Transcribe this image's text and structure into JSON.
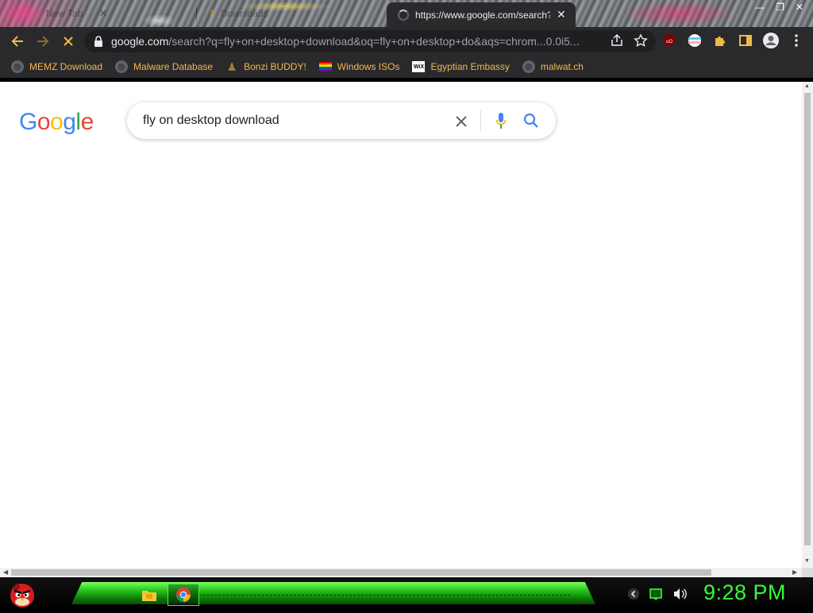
{
  "browser": {
    "tabs": [
      {
        "title": "New Tab",
        "active": false
      },
      {
        "title": "Downloads",
        "active": false
      },
      {
        "title": "https://www.google.com/search?",
        "active": true,
        "loading": true
      }
    ],
    "window_controls": [
      "minimize",
      "restore",
      "close"
    ]
  },
  "toolbar": {
    "url_host": "google.com",
    "url_rest": "/search?q=fly+on+desktop+download&oq=fly+on+desktop+do&aqs=chrom...0.0i5...",
    "extension_icons": [
      "ublock-icon",
      "vpn-icon",
      "extensions-puzzle-icon",
      "sidepanel-icon",
      "profile-icon",
      "kebab-menu-icon"
    ]
  },
  "bookmarks": [
    {
      "label": "MEMZ Download",
      "icon": "globe-icon"
    },
    {
      "label": "Malware Database",
      "icon": "globe-icon"
    },
    {
      "label": "Bonzi BUDDY!",
      "icon": "bonzi-icon"
    },
    {
      "label": "Windows ISOs",
      "icon": "rainbow-flag-icon"
    },
    {
      "label": "Egyptian Embassy",
      "icon": "wix-icon"
    },
    {
      "label": "malwat.ch",
      "icon": "globe-icon"
    }
  ],
  "google": {
    "logo": "Google",
    "query": "fly on desktop download"
  },
  "colors": {
    "g_blue": "#4285F4",
    "g_red": "#EA4335",
    "g_yellow": "#FBBC05",
    "g_green": "#34A853",
    "bookmark_text": "#F0B94D",
    "clock": "#33FF33",
    "chrome_dark": "#2A2A2C"
  },
  "taskbar": {
    "clock": "9:28 PM",
    "apps": [
      "file-explorer-icon",
      "chrome-icon"
    ],
    "tray": [
      "chevron-tray-icon",
      "battery-icon",
      "volume-icon"
    ]
  }
}
